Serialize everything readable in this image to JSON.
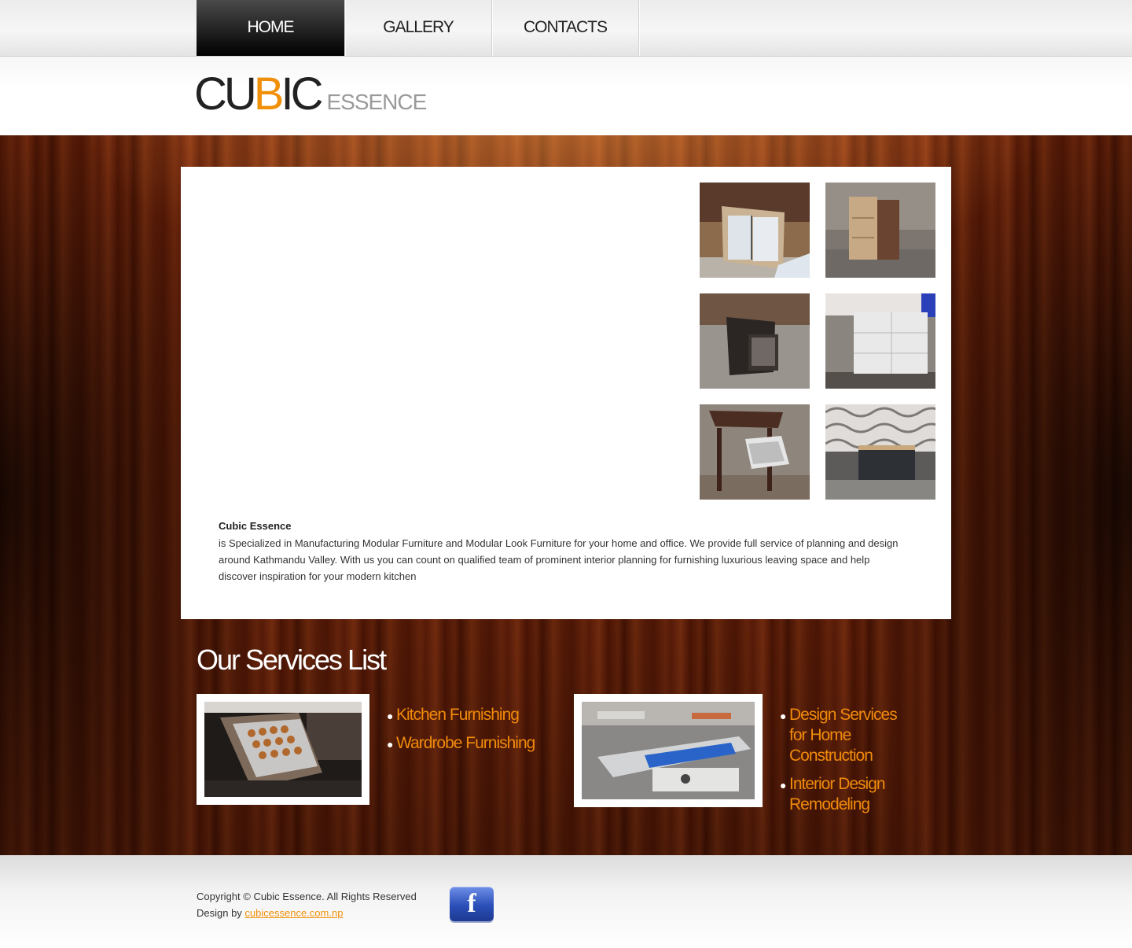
{
  "nav": {
    "items": [
      {
        "label": "HOME",
        "active": true
      },
      {
        "label": "GALLERY",
        "active": false
      },
      {
        "label": "CONTACTS",
        "active": false
      }
    ]
  },
  "logo": {
    "part1": "CU",
    "accent": "B",
    "part2": "IC",
    "subtitle": "ESSENCE",
    "accent_color": "#f0900a"
  },
  "about": {
    "title": "Cubic Essence",
    "text": "is Specialized in Manufacturing Modular Furniture and Modular Look Furniture for your home and office. We provide full service of planning and design around Kathmandu Valley. With us you can count on qualified team of prominent interior planning for furnishing luxurious leaving space and help discover inspiration for your modern kitchen"
  },
  "gallery_thumbs": [
    {
      "icon": "sliding-door-wardrobe-photo"
    },
    {
      "icon": "wooden-nightstand-photo"
    },
    {
      "icon": "dark-drawer-cabinet-photo"
    },
    {
      "icon": "white-drawer-unit-photo"
    },
    {
      "icon": "open-drawer-table-photo"
    },
    {
      "icon": "dark-office-desk-photo"
    }
  ],
  "services": {
    "title": "Our Services List",
    "list_left": [
      "Kitchen Furnishing",
      "Wardrobe Furnishing"
    ],
    "list_right": [
      "Design Services for Home Construction",
      "Interior Design Remodeling"
    ]
  },
  "footer": {
    "copyright": "Copyright © Cubic Essence. All Rights Reserved",
    "design_prefix": "Design by ",
    "design_link": "cubicessence.com.np",
    "facebook_glyph": "f"
  }
}
